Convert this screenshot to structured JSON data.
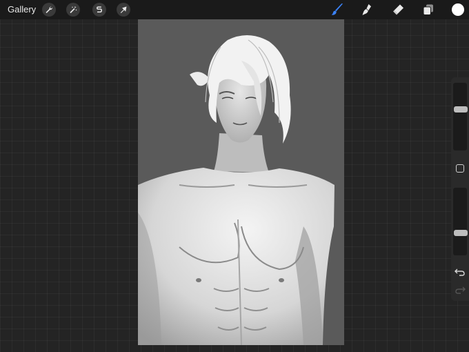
{
  "toolbar": {
    "gallery_label": "Gallery",
    "left_tools": [
      {
        "name": "actions",
        "icon": "wrench-icon"
      },
      {
        "name": "adjustments",
        "icon": "magic-wand-icon"
      },
      {
        "name": "selection",
        "icon": "selection-s-icon"
      },
      {
        "name": "transform",
        "icon": "arrow-cursor-icon"
      }
    ],
    "right_tools": [
      {
        "name": "brush",
        "icon": "brush-icon",
        "active": true
      },
      {
        "name": "smudge",
        "icon": "smudge-icon"
      },
      {
        "name": "eraser",
        "icon": "eraser-icon"
      },
      {
        "name": "layers",
        "icon": "layers-icon"
      }
    ],
    "current_color": "#ffffff",
    "active_color": "#3b82f6"
  },
  "sidebar": {
    "brush_size_level": 0.62,
    "opacity_level": 0.32,
    "modify_icon": "square-icon",
    "undo_icon": "undo-icon",
    "redo_icon": "redo-icon"
  },
  "canvas": {
    "background": "#5a5a5a",
    "artwork": "grayscale-portrait"
  }
}
